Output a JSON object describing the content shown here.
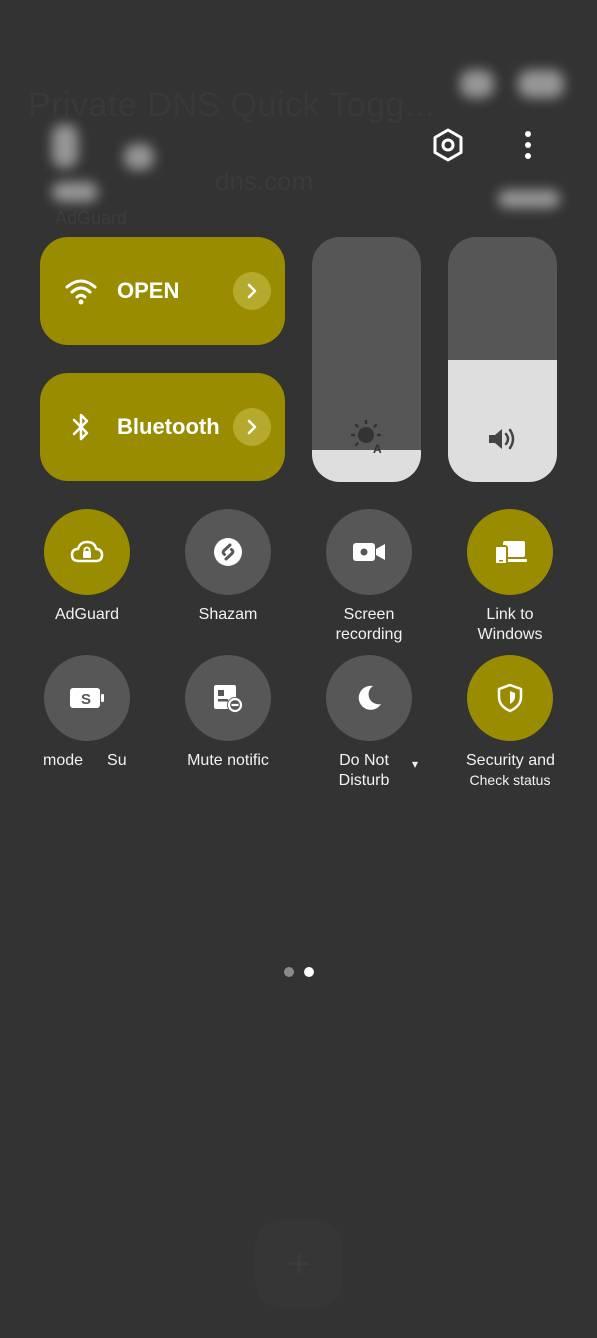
{
  "background_app": {
    "title": "Private DNS Quick Togg...",
    "subtitle": "dns.com",
    "label": "AdGuard"
  },
  "top_icons": [
    "settings-icon",
    "more-options-icon"
  ],
  "big_tiles": {
    "wifi": {
      "label": "OPEN",
      "icon": "wifi-icon",
      "state": "on"
    },
    "bluetooth": {
      "label": "Bluetooth",
      "icon": "bluetooth-icon",
      "state": "on"
    }
  },
  "sliders": {
    "brightness": {
      "icon": "auto-brightness-icon",
      "level": 0.13
    },
    "volume": {
      "icon": "volume-icon",
      "level": 0.5
    }
  },
  "quick_settings_row1": [
    {
      "label": "AdGuard",
      "icon": "cloud-lock-icon",
      "state": "on"
    },
    {
      "label": "Shazam",
      "icon": "shazam-icon",
      "state": "off"
    },
    {
      "label_line1": "Screen",
      "label_line2": "recording",
      "icon": "video-camera-icon",
      "state": "off"
    },
    {
      "label_line1": "Link to",
      "label_line2": "Windows",
      "icon": "link-to-windows-icon",
      "state": "on"
    }
  ],
  "quick_settings_row2": [
    {
      "label": "mode",
      "label_cut": "Su",
      "icon": "battery-saver-icon",
      "state": "off"
    },
    {
      "label": "Mute notific",
      "icon": "mute-notifications-icon",
      "state": "off"
    },
    {
      "label_line1": "Do Not",
      "label_line2": "Disturb",
      "icon": "moon-icon",
      "state": "off",
      "dropdown": "▾"
    },
    {
      "label_line1": "Security and",
      "label_line2": "Check status",
      "icon": "shield-icon",
      "state": "on"
    }
  ],
  "page_indicator": {
    "pages": 2,
    "current": 2
  },
  "colors": {
    "background": "#333333",
    "accent_on": "#9a8c00",
    "tile_off": "#575757",
    "slider_fill": "#dedede",
    "slider_track": "#565656"
  }
}
